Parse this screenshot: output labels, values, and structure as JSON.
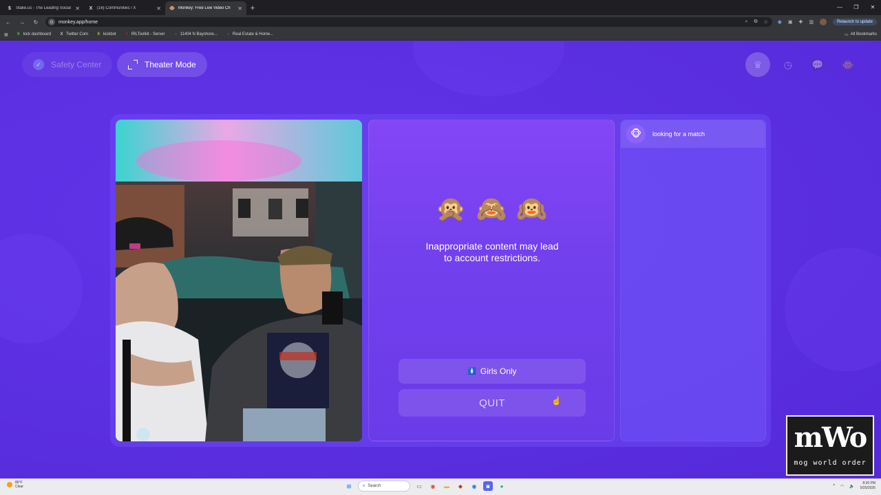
{
  "browser": {
    "tabs": [
      {
        "title": "Stake.us - The Leading Social C",
        "favicon": "$",
        "color": "#e8e8e8",
        "active": false
      },
      {
        "title": "(16) Communities / X",
        "favicon": "X",
        "color": "#e8e8e8",
        "active": false
      },
      {
        "title": "Monkey: Free Live Video Ch",
        "favicon": "🐵",
        "color": "#c58b5b",
        "active": true
      }
    ],
    "new_tab": "+",
    "url": "monkey.app/home",
    "relaunch_label": "Relaunch to update",
    "bookmarks": [
      {
        "label": "kick dashboard",
        "icon": "K",
        "color": "#53fc18"
      },
      {
        "label": "Twitter Com",
        "icon": "X",
        "color": "#ffffff"
      },
      {
        "label": "kickbot",
        "icon": "K",
        "color": "#e0e020"
      },
      {
        "label": "IRLToolkit - Server",
        "icon": "I",
        "color": "#e03030"
      },
      {
        "label": "11404 N Bayshore...",
        "icon": "⌂",
        "color": "#2a7de1"
      },
      {
        "label": "Real Estate & Home...",
        "icon": "⌂",
        "color": "#2a7de1"
      }
    ],
    "all_bookmarks": "All Bookmarks"
  },
  "page": {
    "safety_center": "Safety Center",
    "theater_mode": "Theater Mode",
    "nav_icons": [
      "crown-icon",
      "clock-icon",
      "chat-icon",
      "monkey-avatar-icon"
    ],
    "monkeys": [
      "🙊",
      "🙈",
      "🙉"
    ],
    "warning": "Inappropriate content may lead to account restrictions.",
    "girls_only": "Girls Only",
    "girls_only_icon": "🚺",
    "quit": "QUIT",
    "match_status": "looking for a match",
    "match_avatar": "🐵"
  },
  "watermark": {
    "big": "mWo",
    "small": "mog world order"
  },
  "taskbar": {
    "temperature": "86°F",
    "condition": "Clear",
    "search_label": "Search",
    "time": "8:30 PM",
    "date": "5/25/2026"
  },
  "colors": {
    "page_bg": "#5b2ee0",
    "center_panel": "#8446f6"
  }
}
